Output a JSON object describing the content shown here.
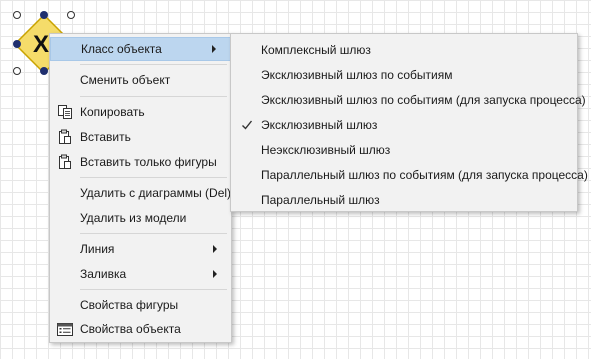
{
  "context_menu": {
    "items": [
      {
        "label": "Класс объекта"
      },
      {
        "label": "Сменить объект"
      },
      {
        "label": "Копировать"
      },
      {
        "label": "Вставить"
      },
      {
        "label": "Вставить только фигуры"
      },
      {
        "label": "Удалить с диаграммы (Del)"
      },
      {
        "label": "Удалить из модели"
      },
      {
        "label": "Линия"
      },
      {
        "label": "Заливка"
      },
      {
        "label": "Свойства фигуры"
      },
      {
        "label": "Свойства объекта"
      }
    ]
  },
  "submenu": {
    "items": [
      {
        "label": "Комплексный шлюз"
      },
      {
        "label": "Эксклюзивный шлюз по событиям"
      },
      {
        "label": "Эксклюзивный шлюз по событиям (для запуска процесса)"
      },
      {
        "label": "Эксклюзивный шлюз",
        "checked": true
      },
      {
        "label": "Неэксклюзивный шлюз"
      },
      {
        "label": "Параллельный шлюз по событиям (для запуска процесса)"
      },
      {
        "label": "Параллельный шлюз"
      }
    ]
  },
  "colors": {
    "highlight": "#bcd6ef",
    "gateway_fill": "#f5dc6a",
    "selection_handle": "#1f2f6f"
  }
}
